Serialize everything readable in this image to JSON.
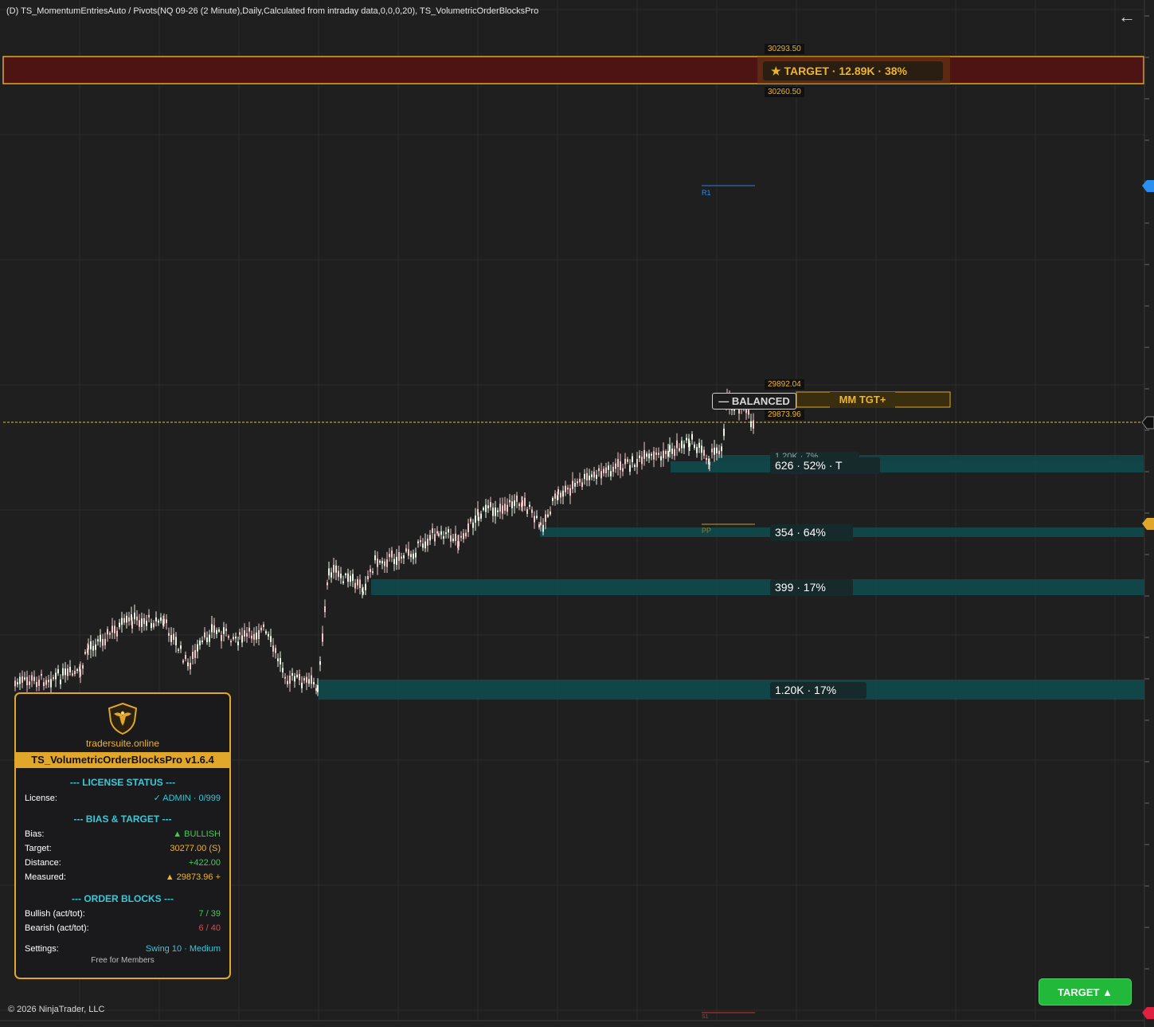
{
  "header": {
    "indicator_line": "(D) TS_MomentumEntriesAuto / Pivots(NQ 09-26 (2 Minute),Daily,Calculated from intraday data,0,0,0,20), TS_VolumetricOrderBlocksPro"
  },
  "colors": {
    "background": "#1f1f1f",
    "gold": "#f0b429",
    "target_zone": "#4e1414",
    "order_block": "#0f4a4c",
    "bullish": "#3fcf4e",
    "bearish": "#e04848",
    "accent_cyan": "#38c8d8",
    "candle_up": "#e8f4e4",
    "candle_down": "#f0c8c8"
  },
  "icons": {
    "back": "arrow-left-icon",
    "logo": "eagle-shield-icon",
    "star": "star-icon"
  },
  "price_labels": {
    "target_top": "30293.50",
    "target_bottom": "30260.50",
    "mm_top": "29892.04",
    "current": "29873.96"
  },
  "target_zone_label": "★ TARGET · 12.89K · 38%",
  "balanced_label": "— BALANCED",
  "mm_target_label": "MM TGT+",
  "pivots": {
    "r1": "R1",
    "pp": "PP",
    "s1": "S1"
  },
  "order_blocks": [
    {
      "label": "1.20K · 7%"
    },
    {
      "label": "626 · 52% · T"
    },
    {
      "label": "354 · 64%"
    },
    {
      "label": "399 · 17%"
    },
    {
      "label": "1.20K · 17%"
    }
  ],
  "copyright": "© 2026 NinjaTrader, LLC",
  "target_button": "TARGET ▲",
  "panel": {
    "site": "tradersuite.online",
    "title": "TS_VolumetricOrderBlocksPro v1.6.4",
    "license_header": "--- LICENSE STATUS ---",
    "license_label": "License:",
    "license_value": "✓ ADMIN · 0/999",
    "bias_header": "--- BIAS & TARGET ---",
    "bias_label": "Bias:",
    "bias_value": "▲ BULLISH",
    "target_label": "Target:",
    "target_value": "30277.00 (S)",
    "distance_label": "Distance:",
    "distance_value": "+422.00",
    "measured_label": "Measured:",
    "measured_value": "▲ 29873.96 +",
    "ob_header": "--- ORDER BLOCKS ---",
    "bullish_label": "Bullish (act/tot):",
    "bullish_value": "7 / 39",
    "bearish_label": "Bearish (act/tot):",
    "bearish_value": "6 / 40",
    "settings_label": "Settings:",
    "settings_value": "Swing 10 · Medium",
    "footer": "Free for Members"
  }
}
